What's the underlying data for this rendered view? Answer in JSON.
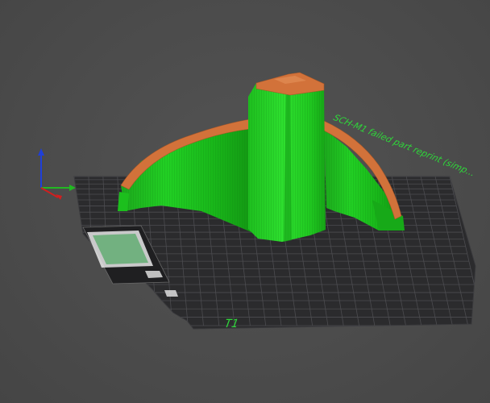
{
  "viewport": {
    "object_label": "SCH-M1 failed part reprint (simp...",
    "bed_number": "T1"
  },
  "colors": {
    "background": "#4a4a4a",
    "bed": "#2b2b2d",
    "grid": "#4c4c50",
    "model_wall": "#1fd321",
    "model_overhang": "#d2723a",
    "axis_x": "#d01f1f",
    "axis_y": "#22b822",
    "axis_z": "#1f3fd8"
  },
  "icons": [
    "axis-gizmo-icon"
  ]
}
